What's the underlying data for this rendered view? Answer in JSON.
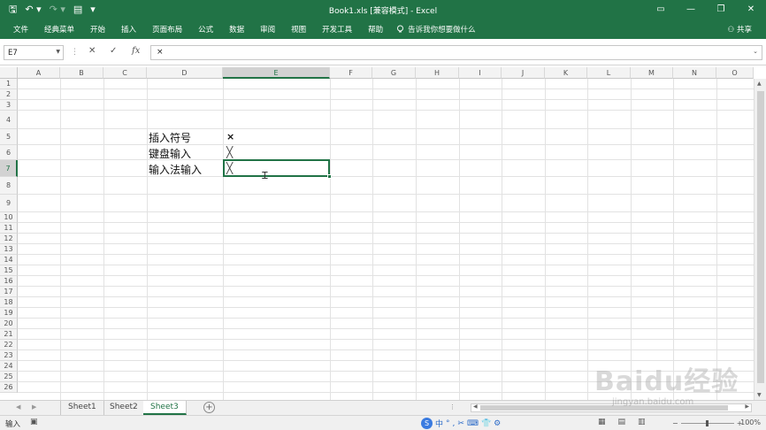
{
  "window": {
    "title": "Book1.xls  [兼容模式]  -  Excel",
    "controls": [
      "▭",
      "—",
      "❐",
      "✕"
    ]
  },
  "qat": {
    "save": "🖫",
    "undo": "↶ ▾",
    "redo": "↷ ▾",
    "extra": "▤",
    "more": "▾"
  },
  "ribbon": {
    "tabs": [
      "文件",
      "经典菜单",
      "开始",
      "插入",
      "页面布局",
      "公式",
      "数据",
      "审阅",
      "视图",
      "开发工具",
      "帮助"
    ],
    "tell_me": "告诉我你想要做什么",
    "share": "共享"
  },
  "formula_bar": {
    "name_box": "E7",
    "cancel": "✕",
    "confirm": "✓",
    "fx": "fx",
    "value": "×"
  },
  "columns": [
    "A",
    "B",
    "C",
    "D",
    "E",
    "F",
    "G",
    "H",
    "I",
    "J",
    "K",
    "L",
    "M",
    "N",
    "O"
  ],
  "selected_column": "E",
  "rows": [
    "1",
    "2",
    "3",
    "4",
    "5",
    "6",
    "7",
    "8",
    "9",
    "10",
    "11",
    "12",
    "13",
    "14",
    "15",
    "16",
    "17",
    "18",
    "19",
    "20",
    "21",
    "22",
    "23",
    "24",
    "25",
    "26"
  ],
  "selected_row": "7",
  "cells": {
    "D5": "插入符号",
    "E5": "×",
    "D6": "键盘输入",
    "E6": "╳",
    "D7": "输入法输入",
    "E7": "╳"
  },
  "sheets": {
    "tabs": [
      "Sheet1",
      "Sheet2",
      "Sheet3"
    ],
    "active": "Sheet3",
    "add": "+"
  },
  "status": {
    "mode": "输入",
    "ime": [
      "中",
      "°",
      ",",
      "✂",
      "⌨",
      "👕",
      "⚙"
    ],
    "zoom": "100%"
  },
  "watermark": {
    "text": "Baidu经验",
    "url": "jingyan.baidu.com"
  },
  "accent_color": "#217346"
}
